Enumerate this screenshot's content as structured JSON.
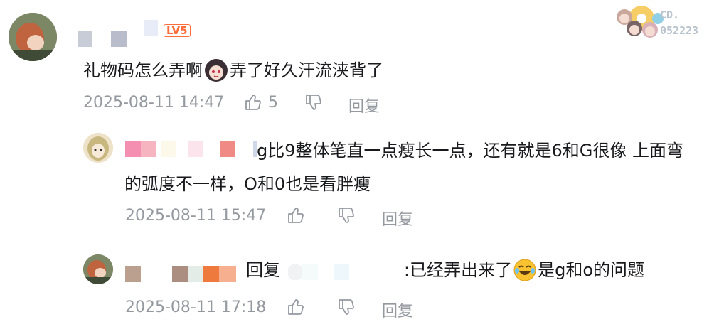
{
  "comments": [
    {
      "level_badge": "LV5",
      "text_before_sticker": "礼物码怎么弄啊",
      "sticker": "anime-girl-sticker",
      "text_after_sticker": "弄了好久汗流浃背了",
      "time": "2025-08-11 14:47",
      "like_count": "5",
      "reply_label": "回复"
    },
    {
      "text_line1": "g比9整体笔直一点瘦长一点，还有就是6和G很像 上面弯",
      "text_line2": "的弧度不一样，O和0也是看胖瘦",
      "time": "2025-08-11 15:47",
      "reply_label": "回复"
    },
    {
      "reply_prefix": "回复",
      "text_before_emoji": ":已经弄出来了",
      "emoji": "laughing-tears-emoji",
      "text_after_emoji": "是g和o的问题",
      "time": "2025-08-11 17:18",
      "reply_label": "回复"
    }
  ],
  "decoration": {
    "sticker_text_line1": "CD.",
    "sticker_text_line2": "052223"
  },
  "colors": {
    "text": "#18191c",
    "meta": "#9499a0",
    "badge": "#ff6d3b"
  }
}
